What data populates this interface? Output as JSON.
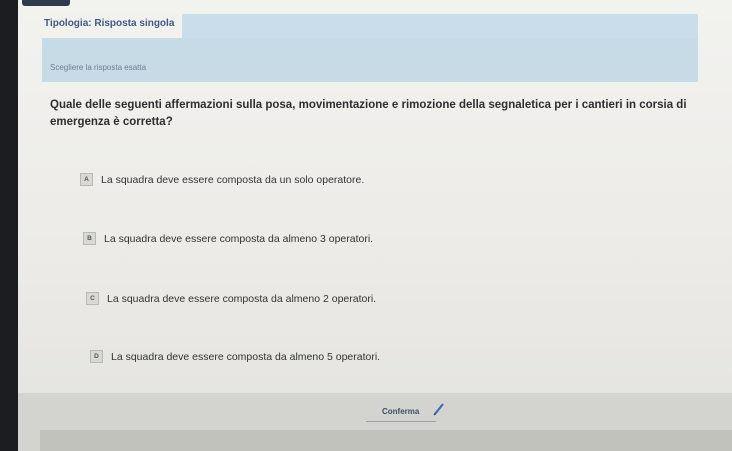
{
  "header": {
    "topic_title": "Tipologia: Risposta singola"
  },
  "instruction": "Scegliere la risposta esatta",
  "question": "Quale delle seguenti affermazioni sulla posa, movimentazione e rimozione della segnaletica per i cantieri in corsia di emergenza è corretta?",
  "options": [
    {
      "letter": "A",
      "text": "La squadra deve essere composta da un solo operatore."
    },
    {
      "letter": "B",
      "text": "La squadra deve essere composta da almeno 3 operatori."
    },
    {
      "letter": "C",
      "text": "La squadra deve essere composta da almeno 2 operatori."
    },
    {
      "letter": "D",
      "text": "La squadra deve essere composta da almeno 5 operatori."
    }
  ],
  "footer": {
    "confirm_label": "Conferma"
  },
  "colors": {
    "accent": "#3f5a86",
    "instruction_band": "#c7dbe6"
  }
}
